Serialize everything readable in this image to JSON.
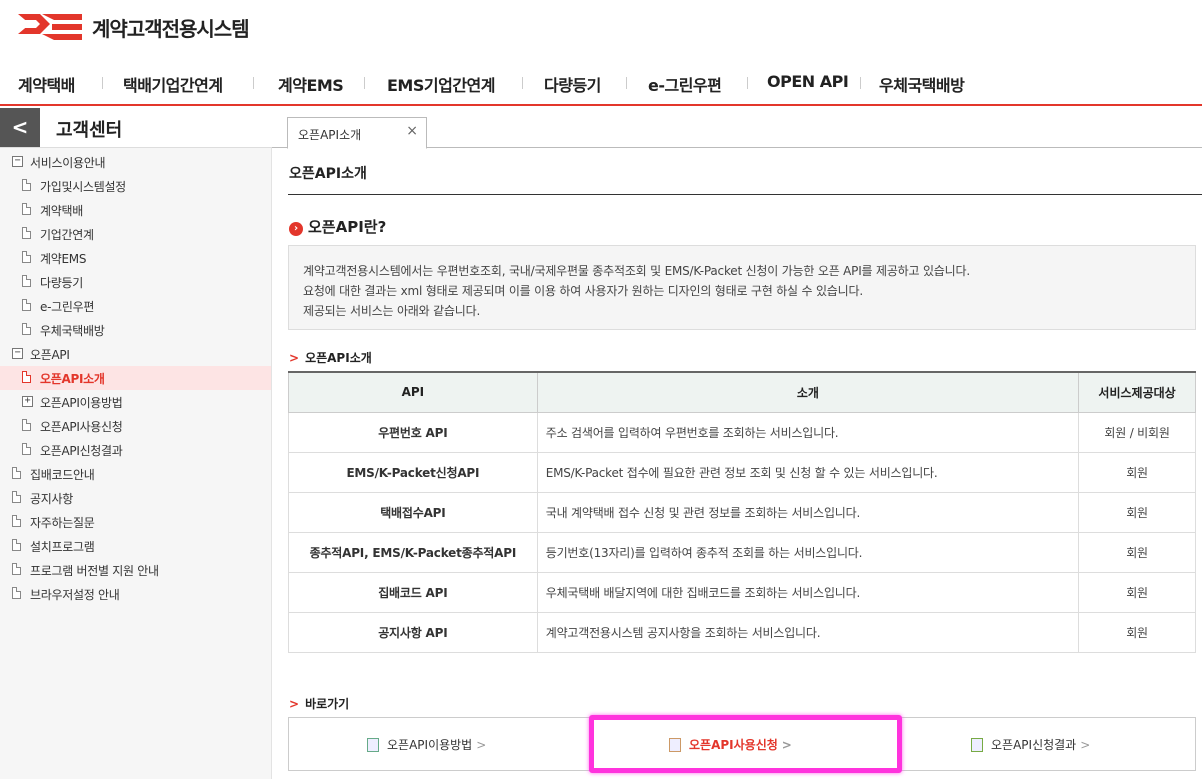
{
  "brand": {
    "title": "계약고객전용시스템",
    "accent": "#e3362b"
  },
  "gnb": [
    "계약택배",
    "택배기업간연계",
    "계약EMS",
    "EMS기업간연계",
    "다량등기",
    "e-그린우편",
    "OPEN API",
    "우체국택배방"
  ],
  "sidebar": {
    "back": "<",
    "title": "고객센터",
    "tree": [
      {
        "label": "서비스이용안내",
        "type": "folder-open",
        "depth": 0
      },
      {
        "label": "가입및시스템설정",
        "type": "doc",
        "depth": 1
      },
      {
        "label": "계약택배",
        "type": "doc",
        "depth": 1
      },
      {
        "label": "기업간연계",
        "type": "doc",
        "depth": 1
      },
      {
        "label": "계약EMS",
        "type": "doc",
        "depth": 1
      },
      {
        "label": "다량등기",
        "type": "doc",
        "depth": 1
      },
      {
        "label": "e-그린우편",
        "type": "doc",
        "depth": 1
      },
      {
        "label": "우체국택배방",
        "type": "doc",
        "depth": 1
      },
      {
        "label": "오픈API",
        "type": "folder-open",
        "depth": 0
      },
      {
        "label": "오픈API소개",
        "type": "doc",
        "depth": 1,
        "active": true
      },
      {
        "label": "오픈API이용방법",
        "type": "folder-closed",
        "depth": 1
      },
      {
        "label": "오픈API사용신청",
        "type": "doc",
        "depth": 1
      },
      {
        "label": "오픈API신청결과",
        "type": "doc",
        "depth": 1
      },
      {
        "label": "집배코드안내",
        "type": "doc",
        "depth": 0
      },
      {
        "label": "공지사항",
        "type": "doc",
        "depth": 0
      },
      {
        "label": "자주하는질문",
        "type": "doc",
        "depth": 0
      },
      {
        "label": "설치프로그램",
        "type": "doc",
        "depth": 0
      },
      {
        "label": "프로그램 버전별 지원 안내",
        "type": "doc",
        "depth": 0
      },
      {
        "label": "브라우저설정 안내",
        "type": "doc",
        "depth": 0
      }
    ]
  },
  "tab": {
    "label": "오픈API소개",
    "close": "×"
  },
  "main": {
    "title": "오픈API소개",
    "section_title": "오픈API란?",
    "section_icon": "›",
    "info_lines": [
      "계약고객전용시스템에서는 우편번호조회, 국내/국제우편물 종추적조회 및 EMS/K-Packet 신청이 가능한 오픈 API를 제공하고 있습니다.",
      "요청에 대한 결과는 xml 형태로 제공되며 이를 이용 하여 사용자가 원하는 디자인의 형태로 구현 하실 수 있습니다.",
      "제공되는 서비스는 아래와 같습니다."
    ],
    "table_title": "오픈API소개",
    "table_headers": [
      "API",
      "소개",
      "서비스제공대상"
    ],
    "table_rows": [
      [
        "우편번호 API",
        "주소 검색어를 입력하여 우편번호를 조회하는 서비스입니다.",
        "회원 / 비회원"
      ],
      [
        "EMS/K-Packet신청API",
        "EMS/K-Packet 접수에 필요한 관련 정보 조회 및 신청 할 수 있는 서비스입니다.",
        "회원"
      ],
      [
        "택배접수API",
        "국내 계약택배 접수 신청 및 관련 정보를 조회하는 서비스입니다.",
        "회원"
      ],
      [
        "종추적API, EMS/K-Packet종추적API",
        "등기번호(13자리)를 입력하여 종추적 조회를 하는 서비스입니다.",
        "회원"
      ],
      [
        "집배코드 API",
        "우체국택배 배달지역에 대한 집배코드를 조회하는 서비스입니다.",
        "회원"
      ],
      [
        "공지사항 API",
        "계약고객전용시스템 공지사항을 조회하는 서비스입니다.",
        "회원"
      ]
    ],
    "quick_title": "바로가기",
    "quick_links": [
      {
        "label": "오픈API이용방법",
        "icon": "doc-search-icon",
        "arrow": ">"
      },
      {
        "label": "오픈API사용신청",
        "icon": "doc-edit-icon",
        "arrow": ">",
        "highlighted": true
      },
      {
        "label": "오픈API신청결과",
        "icon": "doc-check-icon",
        "arrow": ">"
      }
    ],
    "chevron": ">"
  }
}
